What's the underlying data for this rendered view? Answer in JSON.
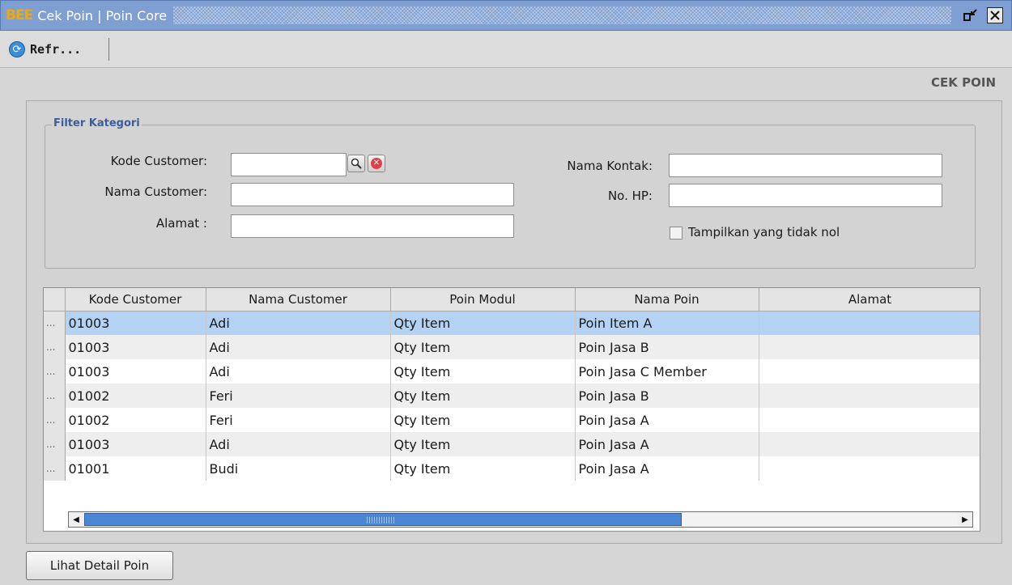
{
  "window": {
    "logo": "BEE",
    "title": "Cek Poin | Poin Core",
    "restore_symbol": "▫↙",
    "close_symbol": "✕"
  },
  "toolbar": {
    "refresh_label": "Refr...",
    "refresh_icon": "refresh-icon"
  },
  "header": {
    "section_label": "CEK POIN"
  },
  "filter": {
    "legend": "Filter Kategori",
    "kode_customer_label": "Kode Customer:",
    "nama_customer_label": "Nama Customer:",
    "alamat_label": "Alamat :",
    "nama_kontak_label": "Nama Kontak:",
    "no_hp_label": "No. HP:",
    "checkbox_label": "Tampilkan yang tidak nol",
    "kode_customer_value": "",
    "nama_customer_value": "",
    "alamat_value": "",
    "nama_kontak_value": "",
    "no_hp_value": "",
    "checkbox_checked": false
  },
  "table": {
    "columns": [
      "Kode Customer",
      "Nama Customer",
      "Poin Modul",
      "Nama Poin",
      "Alamat"
    ],
    "row_header": "...",
    "rows": [
      [
        "01003",
        "Adi",
        "Qty Item",
        "Poin Item A",
        ""
      ],
      [
        "01003",
        "Adi",
        "Qty Item",
        "Poin Jasa B",
        ""
      ],
      [
        "01003",
        "Adi",
        "Qty Item",
        "Poin Jasa C Member",
        ""
      ],
      [
        "01002",
        "Feri",
        "Qty Item",
        "Poin Jasa B",
        ""
      ],
      [
        "01002",
        "Feri",
        "Qty Item",
        "Poin Jasa A",
        ""
      ],
      [
        "01003",
        "Adi",
        "Qty Item",
        "Poin Jasa A",
        ""
      ],
      [
        "01001",
        "Budi",
        "Qty Item",
        "Poin Jasa A",
        ""
      ]
    ],
    "selected_row": 0
  },
  "actions": {
    "detail_label": "Lihat Detail Poin"
  },
  "colors": {
    "titlebar": "#7f9fd2",
    "selected_row": "#b4d3f4",
    "accent": "#3a5d9c"
  }
}
